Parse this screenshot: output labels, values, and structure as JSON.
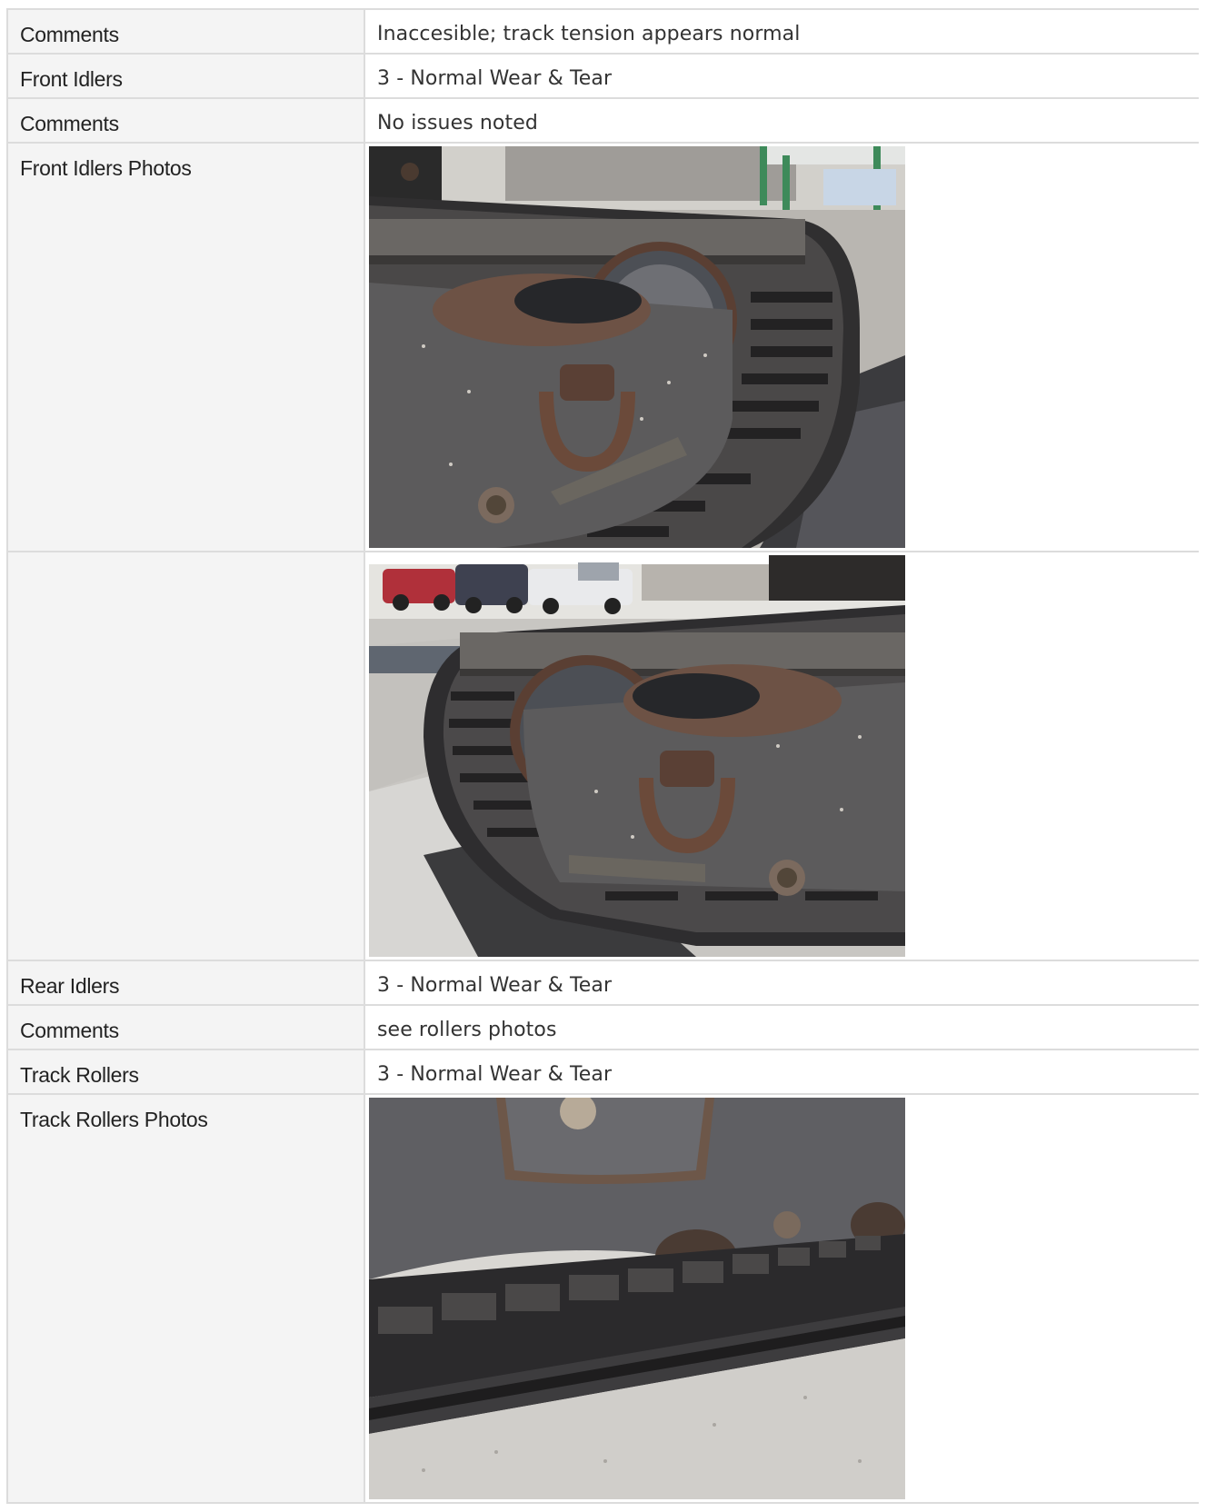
{
  "rows": [
    {
      "label": "Comments",
      "value": "Inaccesible; track tension appears normal"
    },
    {
      "label": "Front Idlers",
      "value": "3 - Normal Wear & Tear"
    },
    {
      "label": "Comments",
      "value": "No issues noted"
    },
    {
      "label": "Front Idlers Photos",
      "photos": [
        "front-idler-left-photo",
        "front-idler-right-photo"
      ]
    },
    {
      "label": "Rear Idlers",
      "value": "3 - Normal Wear & Tear"
    },
    {
      "label": "Comments",
      "value": "see rollers photos"
    },
    {
      "label": "Track Rollers",
      "value": "3 - Normal Wear & Tear"
    },
    {
      "label": "Track Rollers Photos",
      "photos": [
        "track-rollers-photo"
      ]
    }
  ]
}
